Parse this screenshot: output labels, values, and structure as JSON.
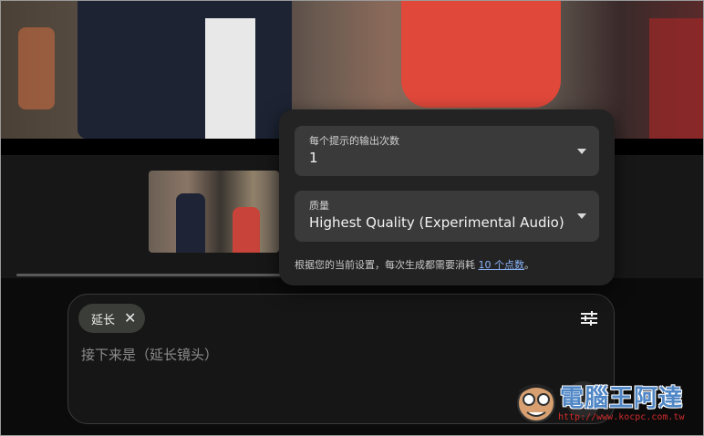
{
  "popup": {
    "outputs_label": "每个提示的输出次数",
    "outputs_value": "1",
    "quality_label": "质量",
    "quality_value": "Highest Quality (Experimental Audio)",
    "info_text": "根据您的当前设置，每次生成都需要消耗 ",
    "info_link": "10 个点数",
    "info_suffix": "。"
  },
  "prompt": {
    "chip_label": "延长",
    "placeholder": "接下来是（延长镜头）"
  },
  "watermark": {
    "brand": "電腦王阿達",
    "url": "http://www.kocpc.com.tw"
  },
  "icons": [
    "close-icon",
    "tune-icon",
    "chevron-down-icon"
  ]
}
